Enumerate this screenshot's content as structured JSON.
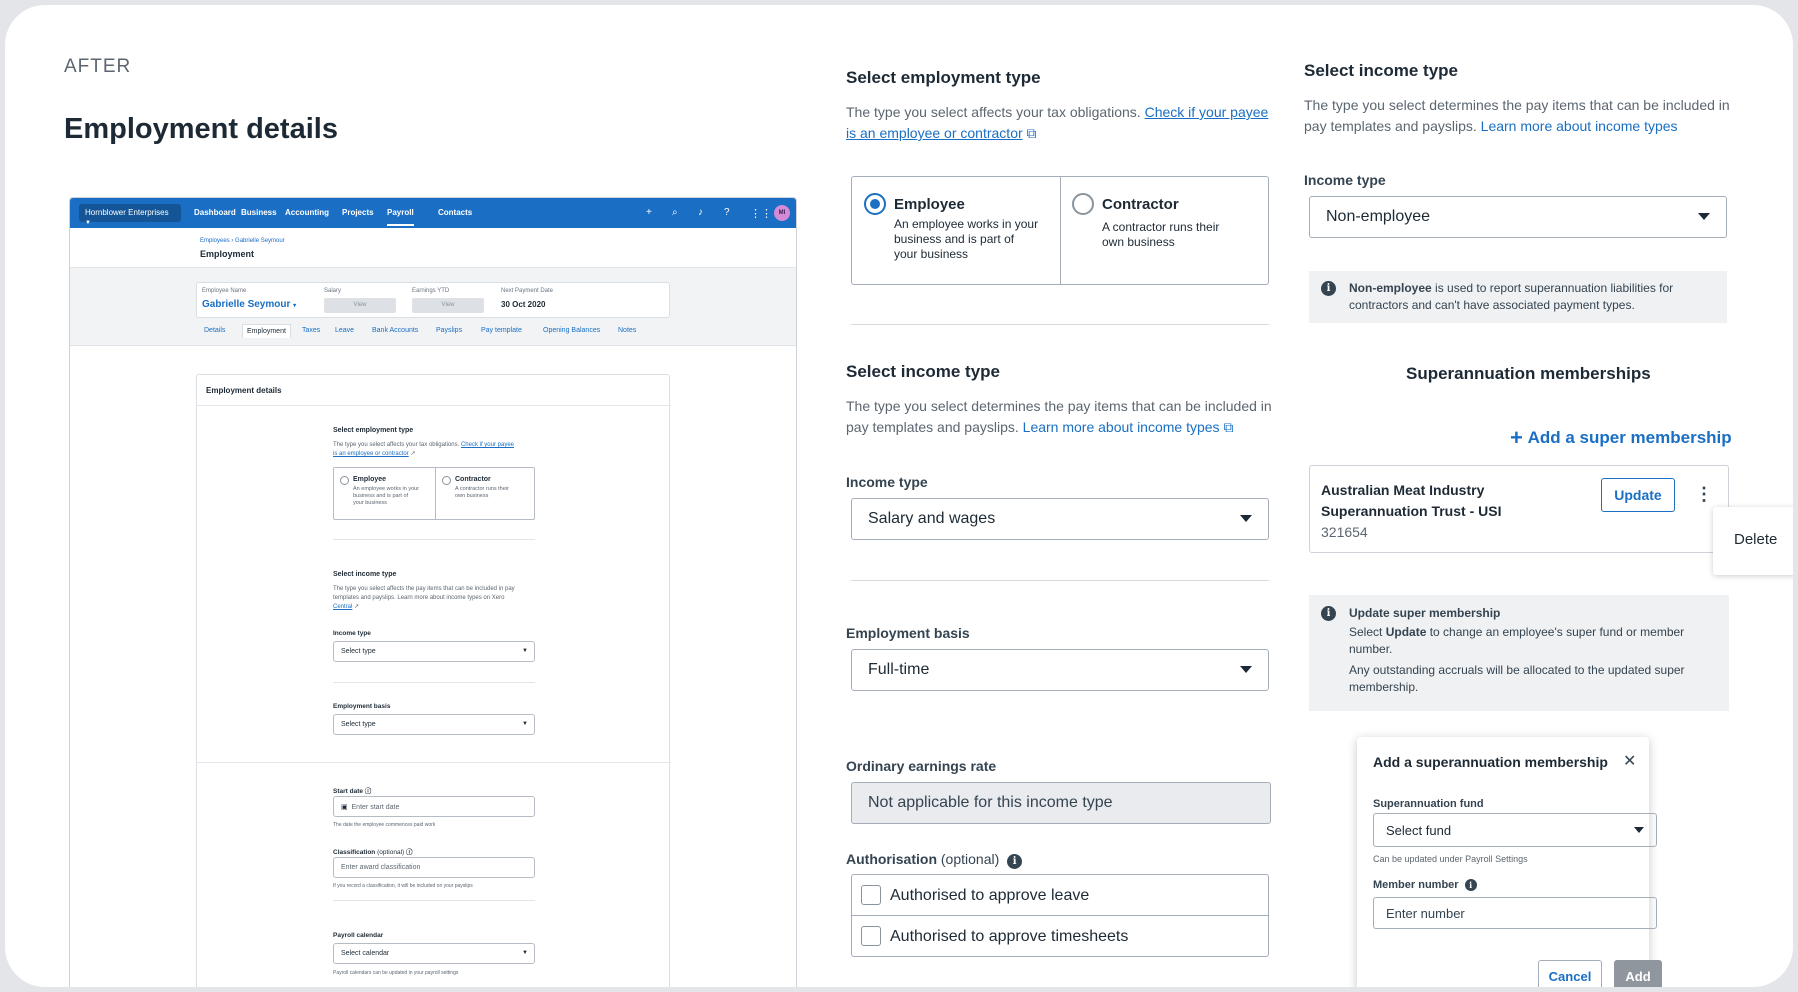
{
  "left": {
    "eyebrow": "AFTER",
    "title": "Employment details"
  },
  "mini": {
    "org": "Hornblower Enterprises",
    "nav": [
      "Dashboard",
      "Business",
      "Accounting",
      "Projects",
      "Payroll",
      "Contacts"
    ],
    "avatar": "MI",
    "breadcrumb": [
      "Employees",
      "Gabrielle Seymour"
    ],
    "page_title": "Employment",
    "summary": {
      "employee_name_label": "Employee Name",
      "employee_name": "Gabrielle Seymour",
      "salary_label": "Salary",
      "earnings_label": "Earnings YTD",
      "view": "View",
      "next_payment_label": "Next Payment Date",
      "next_payment": "30 Oct 2020"
    },
    "tabs": [
      "Details",
      "Employment",
      "Taxes",
      "Leave",
      "Bank Accounts",
      "Payslips",
      "Pay template",
      "Opening Balances",
      "Notes"
    ],
    "card_title": "Employment details",
    "emp_type": {
      "heading": "Select employment type",
      "desc": "The type you select affects your tax obligations.",
      "link1": "Check if your payee",
      "link2": "is an employee or contractor",
      "employee": "Employee",
      "employee_desc": [
        "An employee works in your",
        "business and is part of",
        "your business"
      ],
      "contractor": "Contractor",
      "contractor_desc": [
        "A contractor runs their",
        "own business"
      ]
    },
    "income": {
      "heading": "Select income type",
      "desc1": "The type you select affects the pay items that can be included in pay",
      "desc2": "templates and payslips. Learn more about income types on Xero",
      "desc3": "Central",
      "label": "Income type",
      "value": "Select type"
    },
    "basis": {
      "label": "Employment basis",
      "value": "Select type"
    },
    "start": {
      "label": "Start date",
      "placeholder": "Enter start date",
      "hint": "The date the employee commences paid work"
    },
    "classification": {
      "label": "Classification",
      "optional": "(optional)",
      "placeholder": "Enter award classification",
      "hint": "If you record a classification, it will be included on your payslips"
    },
    "payroll": {
      "label": "Payroll calendar",
      "value": "Select calendar",
      "hint": "Payroll calendars can be updated in your payroll settings"
    }
  },
  "middle": {
    "emp_type_heading": "Select employment type",
    "emp_type_desc": "The type you select affects your tax obligations.",
    "emp_type_link1": "Check if your payee",
    "emp_type_link2": "is an employee or contractor",
    "employee_label": "Employee",
    "employee_desc": [
      "An employee works in your",
      "business and is part of",
      "your business"
    ],
    "contractor_label": "Contractor",
    "contractor_desc": [
      "A contractor runs their",
      "own business"
    ],
    "income_heading": "Select income type",
    "income_desc1": "The type you select determines the pay items that can be included in",
    "income_desc2": "pay templates and payslips.",
    "income_link": "Learn more about income types",
    "income_label": "Income type",
    "income_value": "Salary and wages",
    "basis_label": "Employment basis",
    "basis_value": "Full-time",
    "ordinary_label": "Ordinary earnings rate",
    "ordinary_value": "Not applicable for this income type",
    "auth_label": "Authorisation",
    "auth_optional": "(optional)",
    "auth_leave": "Authorised to approve leave",
    "auth_timesheets": "Authorised to approve timesheets"
  },
  "right": {
    "income_heading": "Select income type",
    "income_desc1": "The type you select determines the pay items that can be included in",
    "income_desc2": "pay templates and payslips.",
    "income_link": "Learn more about income types",
    "income_label": "Income type",
    "income_value": "Non-employee",
    "notice_bold": "Non-employee",
    "notice_text1": "is used to report superannuation liabilities for",
    "notice_text2": "contractors and can't have associated payment types.",
    "super_heading": "Superannuation memberships",
    "add_super": "Add a super membership",
    "fund_name1": "Australian Meat Industry",
    "fund_name2": "Superannuation Trust - USI",
    "fund_number": "321654",
    "update": "Update",
    "delete": "Delete",
    "update_notice_title": "Update super membership",
    "update_notice_1a": "Select",
    "update_notice_1b": "Update",
    "update_notice_1c": "to change an employee's super fund or member",
    "update_notice_1d": "number.",
    "update_notice_2a": "Any outstanding accruals will be allocated to the updated super",
    "update_notice_2b": "membership.",
    "modal": {
      "title": "Add a superannuation membership",
      "fund_label": "Superannuation fund",
      "fund_value": "Select fund",
      "fund_hint": "Can be updated under Payroll Settings",
      "member_label": "Member number",
      "member_placeholder": "Enter number",
      "cancel": "Cancel",
      "add": "Add"
    }
  }
}
